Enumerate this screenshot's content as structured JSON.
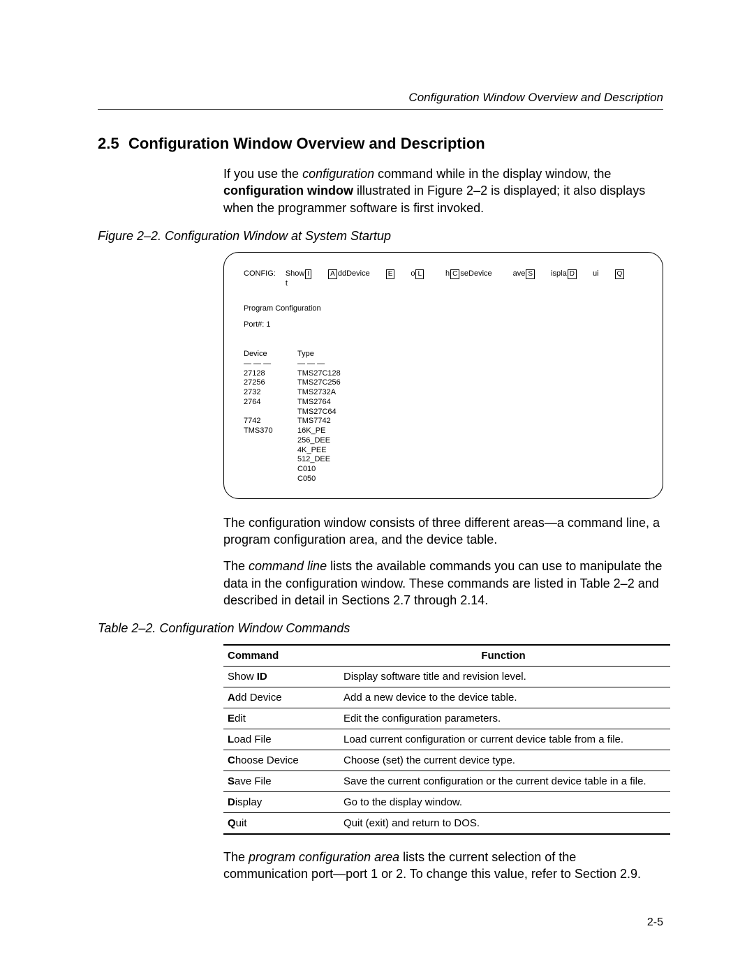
{
  "running_head": "Configuration Window Overview and Description",
  "section": {
    "number": "2.5",
    "title": "Configuration Window Overview and Description"
  },
  "intro_para_parts": {
    "p1_a": "If you use the ",
    "p1_b_ital": "configuration",
    "p1_c": " command while in the display window, the ",
    "p1_d_bold": "configuration window",
    "p1_e": " illustrated in Figure 2–2 is displayed; it also displays when the programmer software is first invoked."
  },
  "figure_caption": "Figure 2–2. Configuration Window at System Startup",
  "config_window": {
    "label": "CONFIG:",
    "cmds": {
      "show_pre": "Show",
      "show_key": "I",
      "show_post": "t",
      "add_key": "A",
      "add_rest": "ddDevice",
      "edit_key": "E",
      "load_pre": "o",
      "load_key": "L",
      "choose_pre": "h",
      "choose_key": "C",
      "choose_post": "seDevice",
      "save_pre": "ave",
      "save_key": "S",
      "disp_pre": "ispla",
      "disp_key": "D",
      "quit_pre": "ui",
      "quit_key": "Q"
    },
    "program_cfg": "Program Configuration",
    "port_line": "Port#: 1",
    "dev_hdr_device": "Device",
    "dev_hdr_type": "Type",
    "device_col": "27128\n27256\n2732\n2764\n\n7742\nTMS370",
    "type_col": "TMS27C128\nTMS27C256\nTMS2732A\nTMS2764\nTMS27C64\nTMS7742\n16K_PE\n256_DEE\n4K_PEE\n512_DEE\nC010\nC050"
  },
  "after_fig_p1": "The configuration window consists of three different areas—a command line, a program configuration area, and the device table.",
  "after_fig_p2_parts": {
    "a": "The ",
    "b_ital": "command line",
    "c": " lists the available commands you can use to manipulate the data in the configuration window. These commands are listed in  Table 2–2 and described in detail in Sections 2.7 through 2.14."
  },
  "table_caption": "Table 2–2. Configuration Window Commands",
  "cmd_table": {
    "head_cmd": "Command",
    "head_fn": "Function",
    "rows": [
      {
        "pre": "Show ",
        "bold": "ID",
        "post": "",
        "fn": "Display software title and revision level."
      },
      {
        "pre": "",
        "bold": "A",
        "post": "dd Device",
        "fn": "Add a new device to the device table."
      },
      {
        "pre": "",
        "bold": "E",
        "post": "dit",
        "fn": "Edit the configuration parameters."
      },
      {
        "pre": "",
        "bold": "L",
        "post": "oad File",
        "fn": "Load current configuration or current device table from a file."
      },
      {
        "pre": "",
        "bold": "C",
        "post": "hoose Device",
        "fn": "Choose (set) the current device type."
      },
      {
        "pre": "",
        "bold": "S",
        "post": "ave File",
        "fn": "Save the current configuration or the current device table in a file."
      },
      {
        "pre": "",
        "bold": "D",
        "post": "isplay",
        "fn": "Go to the display window."
      },
      {
        "pre": "",
        "bold": "Q",
        "post": "uit",
        "fn": "Quit (exit) and return to DOS."
      }
    ]
  },
  "closing_para_parts": {
    "a": "The ",
    "b_ital": "program configuration area",
    "c": " lists the current selection of the communication port—port 1 or 2. To change this value, refer to Section 2.9."
  },
  "page_number": "2-5"
}
